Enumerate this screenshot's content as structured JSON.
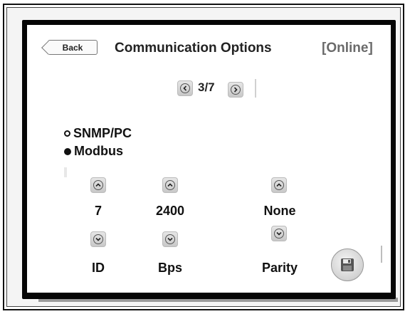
{
  "header": {
    "back_label": "Back",
    "title": "Communication Options",
    "status": "[Online]"
  },
  "pager": {
    "indicator": "3/7"
  },
  "protocol": {
    "options": [
      {
        "label": "SNMP/PC",
        "selected": false
      },
      {
        "label": "Modbus",
        "selected": true
      }
    ]
  },
  "settings": {
    "columns": [
      {
        "value": "7",
        "label": "ID"
      },
      {
        "value": "2400",
        "label": "Bps"
      },
      {
        "value": "None",
        "label": "Parity"
      }
    ]
  },
  "icons": {
    "back": "back-arrow-icon",
    "prev": "chevron-left-icon",
    "next": "chevron-right-icon",
    "increment": "chevron-up-icon",
    "decrement": "chevron-down-icon",
    "save": "floppy-disk-icon"
  }
}
